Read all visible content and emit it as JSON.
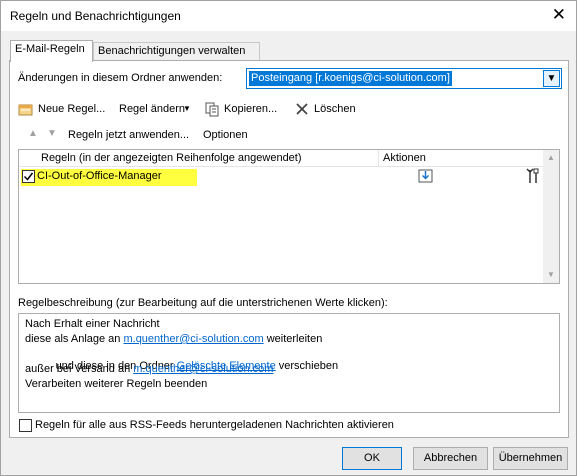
{
  "window": {
    "title": "Regeln und Benachrichtigungen",
    "close_icon": "close-icon"
  },
  "tabs": [
    {
      "label": "E-Mail-Regeln",
      "active": true
    },
    {
      "label": "Benachrichtigungen verwalten",
      "active": false
    }
  ],
  "folder": {
    "label": "Änderungen in diesem Ordner anwenden:",
    "selected": "Posteingang [r.koenigs@ci-solution.com]"
  },
  "toolbar": {
    "new_rule": "Neue Regel...",
    "change_rule": "Regel ändern",
    "copy": "Kopieren...",
    "delete": "Löschen"
  },
  "toolbar2": {
    "apply_now": "Regeln jetzt anwenden...",
    "options": "Optionen"
  },
  "list": {
    "columns": [
      "Regeln (in der angezeigten Reihenfolge angewendet)",
      "Aktionen"
    ],
    "rows": [
      {
        "name": "CI-Out-of-Office-Manager",
        "checked": true
      }
    ]
  },
  "description": {
    "label": "Regelbeschreibung (zur Bearbeitung auf die unterstrichenen Werte klicken):",
    "line1": "Nach Erhalt einer Nachricht",
    "line2_pre": "diese als Anlage an ",
    "line2_link": "m.quenther@ci-solution.com",
    "line2_post": " weiterleiten",
    "line3_pre": "  und diese in den Ordner ",
    "line3_link": "Gelöschte Elemente",
    "line3_post": " verschieben",
    "line4_pre": "außer bei Versand an ",
    "line4_link": "m.quenther@ci-solution.com",
    "line5": "Verarbeiten weiterer Regeln beenden"
  },
  "rss": {
    "label": "Regeln für alle aus RSS-Feeds heruntergeladenen Nachrichten aktivieren",
    "checked": false
  },
  "buttons": {
    "ok": "OK",
    "cancel": "Abbrechen",
    "apply": "Übernehmen"
  },
  "colors": {
    "highlight": "#ffff40",
    "accent": "#0078d7",
    "link": "#0066cc"
  }
}
